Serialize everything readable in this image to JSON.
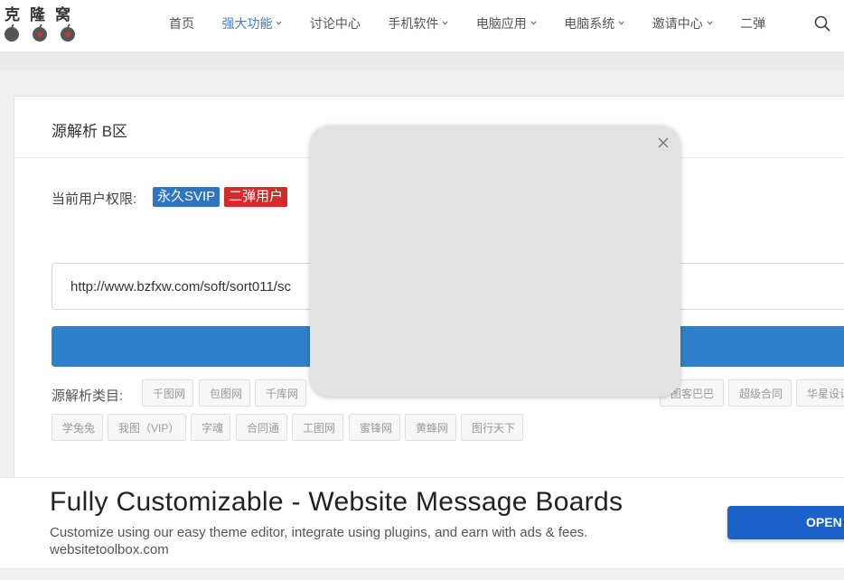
{
  "logo": {
    "text": "克隆窝"
  },
  "nav": {
    "items": [
      {
        "label": "首页",
        "dropdown": false,
        "active": false
      },
      {
        "label": "强大功能",
        "dropdown": true,
        "active": true
      },
      {
        "label": "讨论中心",
        "dropdown": false,
        "active": false
      },
      {
        "label": "手机软件",
        "dropdown": true,
        "active": false
      },
      {
        "label": "电脑应用",
        "dropdown": true,
        "active": false
      },
      {
        "label": "电脑系统",
        "dropdown": true,
        "active": false
      },
      {
        "label": "邀请中心",
        "dropdown": true,
        "active": false
      },
      {
        "label": "二弹",
        "dropdown": false,
        "active": false
      }
    ],
    "search_icon": "search-icon"
  },
  "panel": {
    "title": "源解析 B区",
    "permission_label": "当前用户权限:",
    "badges": [
      {
        "label": "永久SVIP",
        "color": "#2f74c0"
      },
      {
        "label": "二弹用户",
        "color": "#d42a2a"
      }
    ],
    "url_value": "http://www.bzfxw.com/soft/sort011/sc",
    "types_label": "源解析类目:",
    "tags_row1": [
      "千图网",
      "包图网",
      "千库网",
      "",
      "",
      "",
      "",
      "",
      "",
      "图客巴巴",
      "超级合同",
      "华星设计"
    ],
    "tags_row2": [
      "学兔兔",
      "我图（VIP）",
      "字魂",
      "合同通",
      "工图网",
      "蜜锋网",
      "黄蜂网",
      "图行天下"
    ]
  },
  "ad": {
    "title": "Fully Customizable - Website Message Boards",
    "description": "Customize using our easy theme editor, integrate using plugins, and earn with ads & fees.",
    "domain": "websitetoolbox.com",
    "open_label": "OPEN"
  },
  "modal": {
    "close_icon": "close-icon"
  },
  "colors": {
    "accent": "#2f80c8",
    "nav_active": "#3d7ec8",
    "badge_vip": "#2f74c0",
    "badge_red": "#d42a2a",
    "ad_button": "#1a62c9"
  }
}
